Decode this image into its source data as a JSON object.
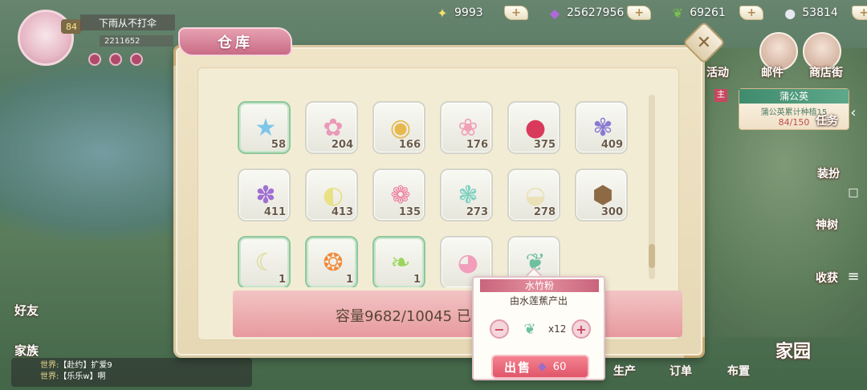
{
  "currencies": [
    {
      "icon": "star-icon",
      "glyph": "✦",
      "color": "#f4e06b",
      "value": "9993"
    },
    {
      "icon": "gem-icon",
      "glyph": "◆",
      "color": "#b06ad8",
      "value": "25627956"
    },
    {
      "icon": "leaf-icon",
      "glyph": "❦",
      "color": "#7bc04f",
      "value": "69261"
    },
    {
      "icon": "rice-icon",
      "glyph": "●",
      "color": "#e8e8ef",
      "value": "53814"
    }
  ],
  "player": {
    "level": "84",
    "name": "下雨从不打伞",
    "id": "2211652"
  },
  "side_labels": {
    "activity": "活动",
    "mail": "邮件",
    "shop": "商店街",
    "task": "任务",
    "dress": "装扮",
    "tree": "神树",
    "collect": "收获",
    "friends": "好友",
    "family": "家族",
    "home": "家园"
  },
  "quest": {
    "badge": "主",
    "title": "蒲公英",
    "text": "蒲公英累计种植15",
    "progress": "84/150"
  },
  "chat": [
    {
      "tag": "世界:",
      "text": "【赴约】扩爱9"
    },
    {
      "tag": "世界:",
      "text": "【乐乐w】啊"
    }
  ],
  "bottom_buttons": {
    "produce": "生产",
    "order": "订单",
    "layout": "布置"
  },
  "warehouse": {
    "title": "仓库",
    "capacity_text": "容量9682/10045  已",
    "items": [
      {
        "icon": "blue-star-icon",
        "glyph": "★",
        "color": "#7ec6e8",
        "count": "58",
        "highlight": true
      },
      {
        "icon": "pink-flower-basket-icon",
        "glyph": "✿",
        "color": "#e99ab8",
        "count": "204",
        "highlight": false
      },
      {
        "icon": "rainbow-egg-basket-icon",
        "glyph": "◉",
        "color": "#e7b84d",
        "count": "166",
        "highlight": false
      },
      {
        "icon": "cherry-blossom-icon",
        "glyph": "❀",
        "color": "#f0a1b6",
        "count": "176",
        "highlight": false
      },
      {
        "icon": "radish-icon",
        "glyph": "●",
        "color": "#d93a5c",
        "count": "375",
        "highlight": false
      },
      {
        "icon": "lavender-icon",
        "glyph": "✾",
        "color": "#8a7ad2",
        "count": "409",
        "highlight": false
      },
      {
        "icon": "purple-grape-flower-icon",
        "glyph": "✽",
        "color": "#a070d2",
        "count": "411",
        "highlight": false
      },
      {
        "icon": "lemon-slice-icon",
        "glyph": "◐",
        "color": "#e9e184",
        "count": "413",
        "highlight": false
      },
      {
        "icon": "pink-fish-basket-icon",
        "glyph": "❁",
        "color": "#ef7fa0",
        "count": "135",
        "highlight": false
      },
      {
        "icon": "lotus-icon",
        "glyph": "❃",
        "color": "#7fd1c1",
        "count": "273",
        "highlight": false
      },
      {
        "icon": "cream-dumpling-icon",
        "glyph": "◒",
        "color": "#eae1b8",
        "count": "278",
        "highlight": false
      },
      {
        "icon": "brown-sack-icon",
        "glyph": "⬢",
        "color": "#8d6a44",
        "count": "300",
        "highlight": false
      },
      {
        "icon": "moon-cake-icon",
        "glyph": "☾",
        "color": "#d7d78e",
        "count": "1",
        "highlight": true
      },
      {
        "icon": "orange-bird-basket-icon",
        "glyph": "❂",
        "color": "#f08a3c",
        "count": "1",
        "highlight": true
      },
      {
        "icon": "green-sprout-icon",
        "glyph": "❧",
        "color": "#9ad65b",
        "count": "1",
        "highlight": true
      },
      {
        "icon": "pink-egg-basket-icon",
        "glyph": "◕",
        "color": "#f29dbb",
        "count": "",
        "highlight": false
      },
      {
        "icon": "green-leaf-powder-icon",
        "glyph": "❦",
        "color": "#6fc09d",
        "count": "",
        "highlight": false
      }
    ]
  },
  "tooltip": {
    "name": "水竹粉",
    "desc": "由水莲蕉产出",
    "qty": "x12",
    "minus": "−",
    "plus": "+",
    "sell_label": "出售",
    "sell_price": "60"
  },
  "nav": {
    "back": "‹",
    "home": "□",
    "menu": "≡"
  }
}
